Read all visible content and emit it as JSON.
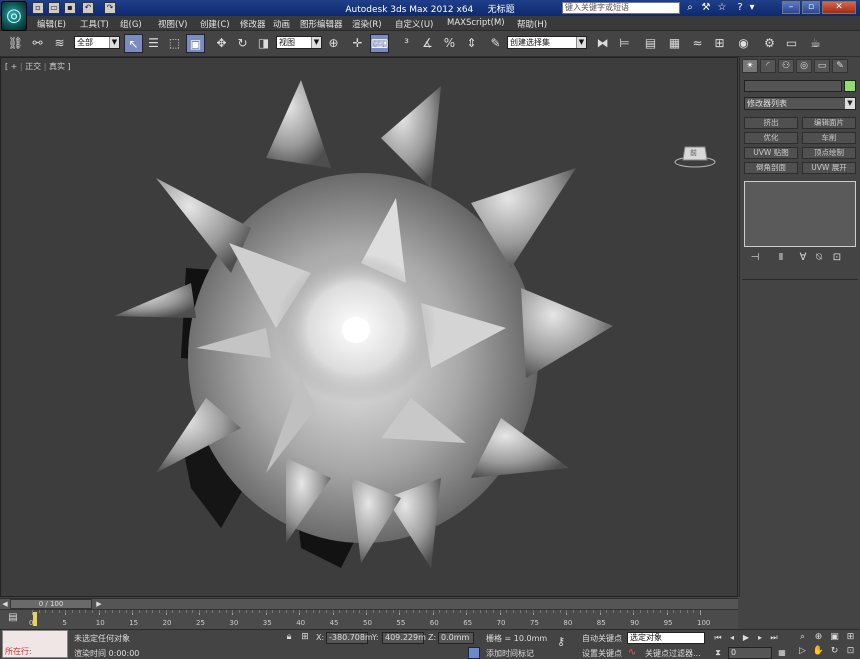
{
  "titlebar": {
    "app_title": "Autodesk 3ds Max  2012 x64",
    "doc_title": "无标题",
    "search_placeholder": "键入关键字或短语"
  },
  "menu": [
    "编辑(E)",
    "工具(T)",
    "组(G)",
    "视图(V)",
    "创建(C)",
    "修改器",
    "动画",
    "图形编辑器",
    "渲染(R)",
    "自定义(U)",
    "MAXScript(M)",
    "帮助(H)"
  ],
  "toolbar": {
    "filter_value": "全部",
    "coord_value": "视图",
    "named_selection": "创建选择集"
  },
  "viewport": {
    "label_plus": "+",
    "label_view": "正交",
    "label_shading": "真实",
    "viewcube_label": "前"
  },
  "command_panel": {
    "modifier_list": "修改器列表",
    "buttons": [
      "挤出",
      "编辑面片",
      "优化",
      "车削",
      "UVW 贴图",
      "顶点绘制",
      "倒角剖面",
      "UVW 展开"
    ]
  },
  "timeline": {
    "slider_text": "0 / 100",
    "ticks": [
      "0",
      "5",
      "10",
      "15",
      "20",
      "25",
      "30",
      "35",
      "40",
      "45",
      "50",
      "55",
      "60",
      "65",
      "70",
      "75",
      "80",
      "85",
      "90",
      "95",
      "100"
    ]
  },
  "status": {
    "maxscript_text": "所在行:",
    "selection": "未选定任何对象",
    "render_time": "渲染时间 0:00:00",
    "x_label": "X:",
    "x_value": "-380.708m",
    "y_label": "Y:",
    "y_value": "409.229m",
    "z_label": "Z:",
    "z_value": "0.0mm",
    "grid": "栅格 = 10.0mm",
    "add_tag": "添加时间标记",
    "auto_key": "自动关键点",
    "set_key": "设置关键点",
    "key_select_value": "选定对象",
    "key_filter": "关键点过滤器...",
    "frame_value": "0"
  }
}
